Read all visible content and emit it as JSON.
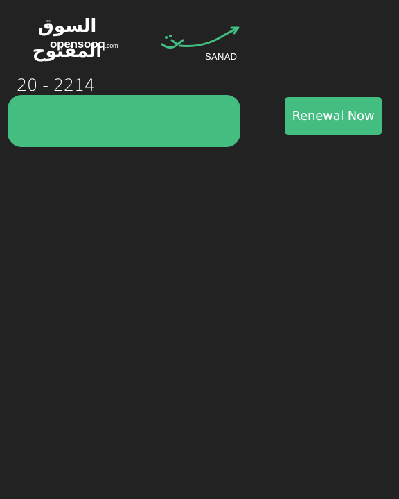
{
  "header": {
    "opensooq_logo": {
      "arabic_name": "السوق المفتوح",
      "latin_name": "opensooq",
      "latin_tld": ".com"
    },
    "sanad_logo": {
      "name": "SANAD",
      "mark_icon": "sanad-swoosh-icon"
    }
  },
  "record": {
    "number": "20 - 2214"
  },
  "actions": {
    "renew_label": "Renewal Now"
  },
  "colors": {
    "background": "#222222",
    "accent_green": "#43be80",
    "text": "#ffffff"
  }
}
